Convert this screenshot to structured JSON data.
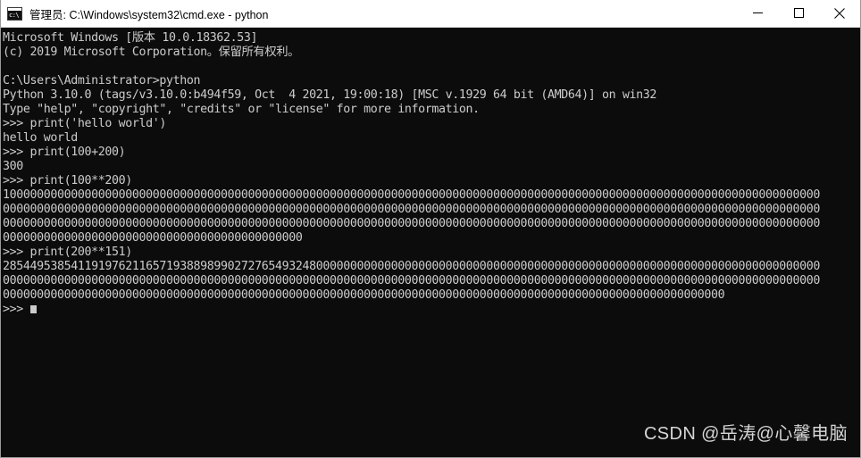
{
  "window": {
    "title": "管理员: C:\\Windows\\system32\\cmd.exe - python",
    "icon": "cmd-console-icon",
    "icon_glyph": "c:\\",
    "controls": {
      "minimize": "minimize-button",
      "maximize": "maximize-button",
      "close": "close-button"
    },
    "background": "#0c0c0c",
    "text_color": "#cccccc"
  },
  "console": {
    "lines": [
      "Microsoft Windows [版本 10.0.18362.53]",
      "(c) 2019 Microsoft Corporation。保留所有权利。",
      "",
      "C:\\Users\\Administrator>python",
      "Python 3.10.0 (tags/v3.10.0:b494f59, Oct  4 2021, 19:00:18) [MSC v.1929 64 bit (AMD64)] on win32",
      "Type \"help\", \"copyright\", \"credits\" or \"license\" for more information.",
      ">>> print('hello world')",
      "hello world",
      ">>> print(100+200)",
      "300",
      ">>> print(100**200)",
      "100000000000000000000000000000000000000000000000000000000000000000000000000000000000000000000000000000000000000000000000",
      "000000000000000000000000000000000000000000000000000000000000000000000000000000000000000000000000000000000000000000000000",
      "000000000000000000000000000000000000000000000000000000000000000000000000000000000000000000000000000000000000000000000000",
      "00000000000000000000000000000000000000000000",
      ">>> print(200**151)",
      "285449538541191976211657193889899027276549324800000000000000000000000000000000000000000000000000000000000000000000000000",
      "000000000000000000000000000000000000000000000000000000000000000000000000000000000000000000000000000000000000000000000000",
      "0000000000000000000000000000000000000000000000000000000000000000000000000000000000000000000000000000000000",
      ">>> "
    ],
    "prompt": ">>> ",
    "cursor_visible": true
  },
  "watermark": {
    "text": "CSDN @岳涛@心馨电脑"
  }
}
